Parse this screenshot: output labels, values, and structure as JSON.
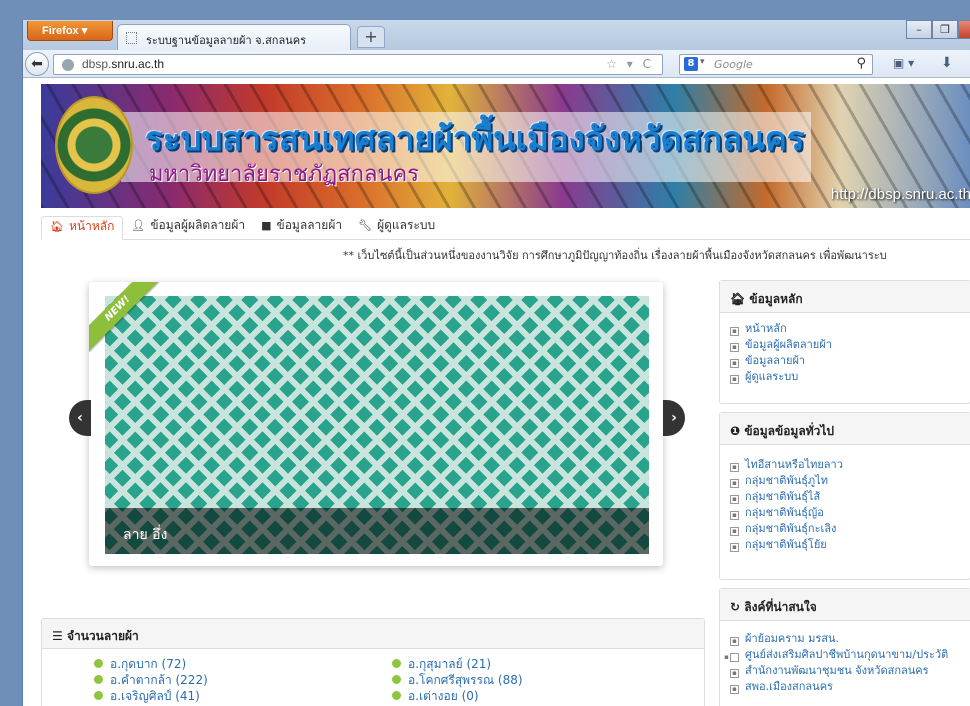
{
  "browser": {
    "app_button": "Firefox",
    "tab_title": "ระบบฐานข้อมูลลายผ้า จ.สกลนคร",
    "new_tab": "+",
    "url_host": "dbsp.",
    "url_domain": "snru.ac.th",
    "search_engine": "8",
    "search_placeholder": "Google"
  },
  "banner": {
    "title": "ระบบสารสนเทศลายผ้าพื้นเมืองจังหวัดสกลนคร",
    "subtitle": "มหาวิทยาลัยราชภัฏสกลนคร",
    "url": "http://dbsp.snru.ac.th"
  },
  "menu": [
    {
      "label": "หน้าหลัก",
      "icon": "home-icon"
    },
    {
      "label": "ข้อมูลผู้ผลิตลายผ้า",
      "icon": "user-icon"
    },
    {
      "label": "ข้อมูลลายผ้า",
      "icon": "book-icon"
    },
    {
      "label": "ผู้ดูแลระบบ",
      "icon": "wrench-icon"
    }
  ],
  "marquee": "** เว็บไซต์นี้เป็นส่วนหนึ่งของงานวิจัย การศึกษาภูมิปัญญาท้องถิ่น เรื่องลายผ้าพื้นเมืองจังหวัดสกลนคร เพื่อพัฒนาระบ",
  "slider": {
    "ribbon": "NEW!",
    "caption": "ลาย อึ่ง",
    "prev": "‹",
    "next": "›"
  },
  "stats": {
    "title": "จำนวนลายผ้า",
    "items": [
      "อ.กุดบาก (72)",
      "อ.กุสุมาลย์ (21)",
      "อ.คำตากล้า (222)",
      "อ.โคกศรีสุพรรณ (88)",
      "อ.เจริญศิลป์ (41)",
      "อ.เต่างอย (0)"
    ]
  },
  "side": {
    "main": {
      "title": "ข้อมูลหลัก",
      "items": [
        "หน้าหลัก",
        "ข้อมูลผู้ผลิตลายผ้า",
        "ข้อมูลลายผ้า",
        "ผู้ดูแลระบบ"
      ]
    },
    "general": {
      "title": "ข้อมูลข้อมูลทั่วไป",
      "items": [
        "ไทอีสานหรือไทยลาว",
        "กลุ่มชาติพันธุ์ภูไท",
        "กลุ่มชาติพันธุ์ไส้",
        "กลุ่มชาติพันธุ์ญ้อ",
        "กลุ่มชาติพันธุ์กะเลิง",
        "กลุ่มชาติพันธุ์โย้ย"
      ]
    },
    "links": {
      "title": "ลิงค์ที่น่าสนใจ",
      "items": [
        "ผ้าย้อมคราม มรสน.",
        "ศูนย์ส่งเสริมศิลปาชีพบ้านกุดนาขาม/ประวัติ",
        "สำนักงานพัฒนาชุมชน จังหวัดสกลนคร",
        "สพอ.เมืองสกลนคร"
      ]
    }
  }
}
